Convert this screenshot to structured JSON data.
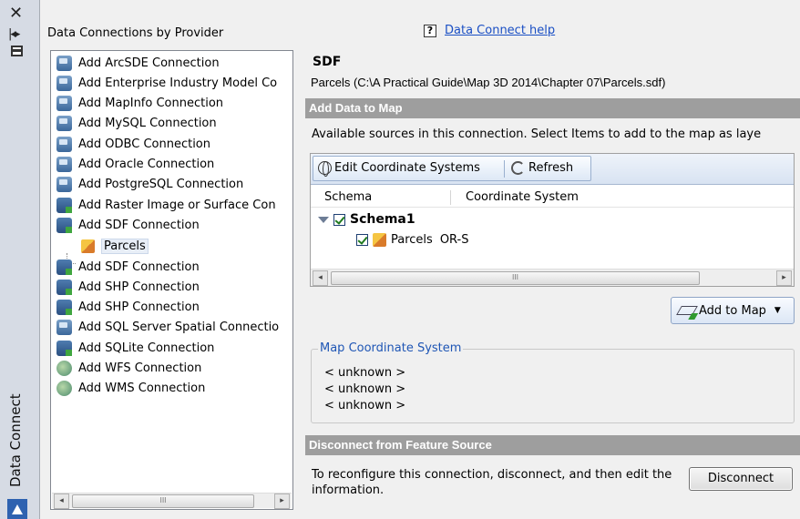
{
  "palette": {
    "title": "Data Connect",
    "close_icon": "close-icon",
    "pin_icon": "auto-hide-icon",
    "properties_icon": "properties-icon",
    "logo_icon": "autodesk-logo-icon"
  },
  "left_panel": {
    "title": "Data Connections by Provider",
    "items": [
      {
        "label": "Add ArcSDE Connection",
        "icon": "database-icon"
      },
      {
        "label": "Add Enterprise Industry Model Co",
        "icon": "database-icon"
      },
      {
        "label": "Add MapInfo Connection",
        "icon": "database-icon"
      },
      {
        "label": "Add MySQL Connection",
        "icon": "database-icon"
      },
      {
        "label": "Add ODBC Connection",
        "icon": "database-icon"
      },
      {
        "label": "Add Oracle Connection",
        "icon": "database-icon"
      },
      {
        "label": "Add PostgreSQL Connection",
        "icon": "database-icon"
      },
      {
        "label": "Add Raster Image or Surface Con",
        "icon": "raster-icon"
      },
      {
        "label": "Add SDF Connection",
        "icon": "sdf-icon"
      },
      {
        "label": "Parcels",
        "icon": "feature-cube-icon"
      },
      {
        "label": "Add SDF Connection",
        "icon": "sdf-icon"
      },
      {
        "label": "Add SHP Connection",
        "icon": "shp-icon"
      },
      {
        "label": "Add SHP Connection",
        "icon": "shp-icon"
      },
      {
        "label": "Add SQL Server Spatial Connectio",
        "icon": "database-icon"
      },
      {
        "label": "Add SQLite Connection",
        "icon": "sdf-icon"
      },
      {
        "label": "Add WFS Connection",
        "icon": "world-icon"
      },
      {
        "label": "Add WMS Connection",
        "icon": "world-icon"
      }
    ],
    "scroll_thumb_glyph": "III"
  },
  "right_panel": {
    "help_glyph": "?",
    "help_link": "Data Connect help",
    "provider": "SDF",
    "connection_path": "Parcels (C:\\A Practical Guide\\Map 3D 2014\\Chapter 07\\Parcels.sdf)",
    "add_data_header": "Add Data to Map",
    "available_text": "Available sources in this connection.  Select Items to add to the map as laye",
    "toolbar": {
      "edit_cs_label": "Edit Coordinate Systems",
      "refresh_label": "Refresh"
    },
    "grid": {
      "headers": [
        "Schema",
        "Coordinate System"
      ],
      "schema_name": "Schema1",
      "feature_name": "Parcels",
      "feature_cs": "OR-S",
      "scroll_thumb_glyph": "III"
    },
    "add_to_map_label": "Add to Map",
    "map_cs": {
      "legend": "Map Coordinate System",
      "lines": [
        "< unknown >",
        "< unknown >",
        "< unknown >"
      ]
    },
    "disconnect_header": "Disconnect from Feature Source",
    "disconnect_text": "To reconfigure this connection, disconnect, and then edit the information.",
    "disconnect_label": "Disconnect"
  }
}
